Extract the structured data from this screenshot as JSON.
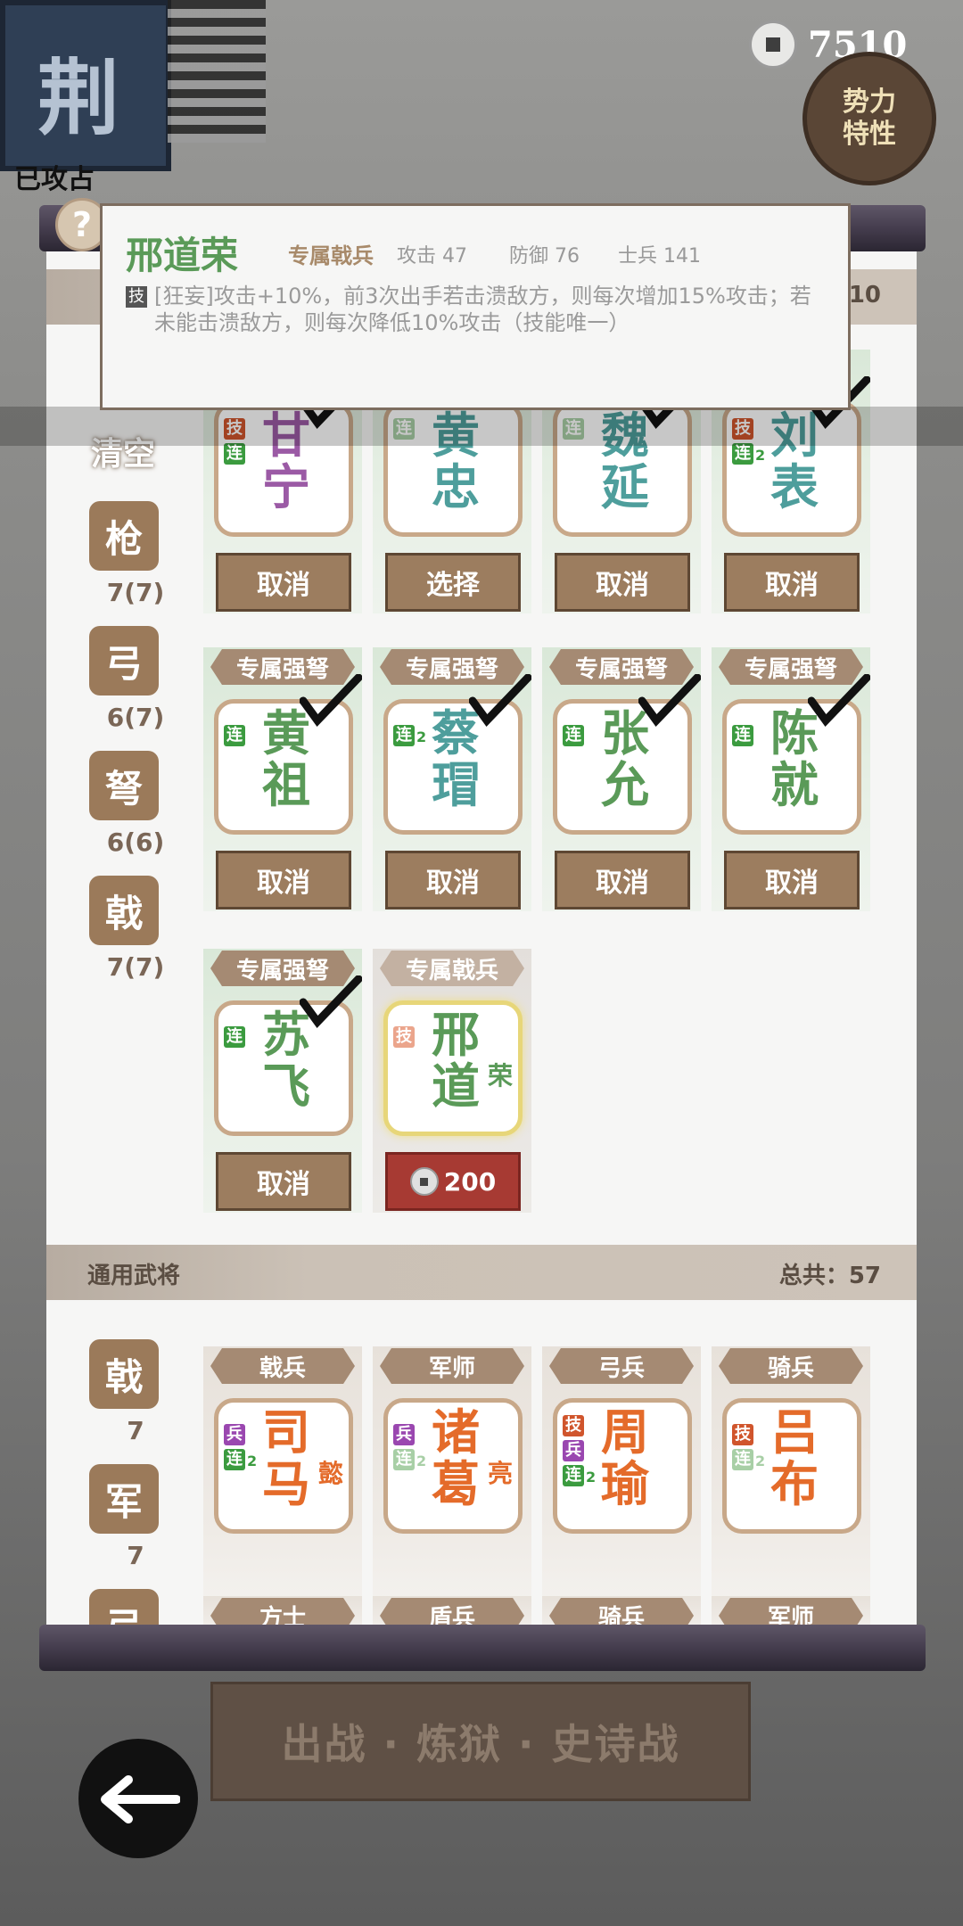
{
  "header": {
    "flag_char": "荆",
    "attacked_label": "已攻占",
    "coin_value": "7510",
    "traits_line1": "势力",
    "traits_line2": "特性"
  },
  "tooltip": {
    "help": "?",
    "name": "邢道荣",
    "type": "专属戟兵",
    "attack": "攻击 47",
    "defense": "防御 76",
    "soldiers": "士兵 141",
    "skill_badge": "技",
    "description": "[狂妄]攻击+10%，前3次出手若击溃敌方，则每次增加15%攻击；若未能击溃敌方，则每次降低10%攻击（技能唯一）",
    "partial_count": "10"
  },
  "sidebar": {
    "clear_label": "清空",
    "filters": [
      {
        "label": "枪",
        "count": "7(7)"
      },
      {
        "label": "弓",
        "count": "6(7)"
      },
      {
        "label": "弩",
        "count": "6(6)"
      },
      {
        "label": "戟",
        "count": "7(7)"
      }
    ]
  },
  "exclusive": {
    "row1": [
      {
        "n1": "甘",
        "n2": "宁",
        "badges": [
          "技",
          "连"
        ],
        "button": "取消"
      },
      {
        "n1": "黄",
        "n2": "忠",
        "badges": [
          "连"
        ],
        "button": "选择"
      },
      {
        "n1": "魏",
        "n2": "延",
        "badges": [
          "连"
        ],
        "button": "取消"
      },
      {
        "n1": "刘",
        "n2": "表",
        "badges": [
          "技",
          "连"
        ],
        "badge_num": "2",
        "button": "取消"
      }
    ],
    "row2": [
      {
        "tag": "专属强弩",
        "n1": "黄",
        "n2": "祖",
        "badges": [
          "连"
        ],
        "button": "取消"
      },
      {
        "tag": "专属强弩",
        "n1": "蔡",
        "n2": "瑁",
        "badges": [
          "连"
        ],
        "badge_num": "2",
        "button": "取消"
      },
      {
        "tag": "专属强弩",
        "n1": "张",
        "n2": "允",
        "badges": [
          "连"
        ],
        "button": "取消"
      },
      {
        "tag": "专属强弩",
        "n1": "陈",
        "n2": "就",
        "badges": [
          "连"
        ],
        "button": "取消"
      }
    ],
    "row3": [
      {
        "tag": "专属强弩",
        "n1": "苏",
        "n2": "飞",
        "badges": [
          "连"
        ],
        "button": "取消"
      },
      {
        "tag": "专属戟兵",
        "n1": "邢",
        "n2": "道",
        "n3": "荣",
        "badges": [
          "技"
        ],
        "price": "200"
      }
    ]
  },
  "general": {
    "label": "通用武将",
    "total": "总共：57",
    "filters": [
      {
        "label": "戟",
        "count": "7"
      },
      {
        "label": "军",
        "count": "7"
      },
      {
        "label": "弓"
      }
    ],
    "cards": [
      {
        "tag": "戟兵",
        "n1": "司",
        "n2": "马",
        "n3": "懿",
        "badges": [
          "兵",
          "连"
        ],
        "badge_num": "2"
      },
      {
        "tag": "军师",
        "n1": "诸",
        "n2": "葛",
        "n3": "亮",
        "badges": [
          "兵",
          "连"
        ],
        "badge_num": "2"
      },
      {
        "tag": "弓兵",
        "n1": "周",
        "n2": "瑜",
        "badges": [
          "技",
          "兵",
          "连"
        ],
        "badge_num": "2"
      },
      {
        "tag": "骑兵",
        "n1": "吕",
        "n2": "布",
        "badges": [
          "技",
          "连"
        ],
        "badge_num": "2"
      }
    ],
    "next_tags": [
      "方士",
      "盾兵",
      "骑兵",
      "军师"
    ]
  },
  "footer": {
    "battle_label": "出战 · 炼狱 · 史诗战"
  }
}
